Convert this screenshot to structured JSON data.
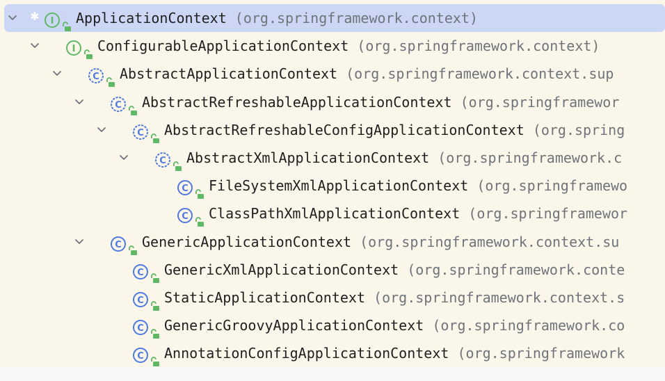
{
  "hierarchy": {
    "nodes": [
      {
        "name": "ApplicationContext",
        "package": "(org.springframework.context)",
        "kind": "interface",
        "depth": 0,
        "expanded": true,
        "selected": true,
        "starred": true
      },
      {
        "name": "ConfigurableApplicationContext",
        "package": "(org.springframework.context)",
        "kind": "interface",
        "depth": 1,
        "expanded": true
      },
      {
        "name": "AbstractApplicationContext",
        "package": "(org.springframework.context.sup",
        "kind": "abstract-class",
        "depth": 2,
        "expanded": true
      },
      {
        "name": "AbstractRefreshableApplicationContext",
        "package": "(org.springframewor",
        "kind": "abstract-class",
        "depth": 3,
        "expanded": true
      },
      {
        "name": "AbstractRefreshableConfigApplicationContext",
        "package": "(org.spring",
        "kind": "abstract-class",
        "depth": 4,
        "expanded": true
      },
      {
        "name": "AbstractXmlApplicationContext",
        "package": "(org.springframework.c",
        "kind": "abstract-class",
        "depth": 5,
        "expanded": true
      },
      {
        "name": "FileSystemXmlApplicationContext",
        "package": "(org.springframewo",
        "kind": "class",
        "depth": 6,
        "expanded": false
      },
      {
        "name": "ClassPathXmlApplicationContext",
        "package": "(org.springframewor",
        "kind": "class",
        "depth": 6,
        "expanded": false
      },
      {
        "name": "GenericApplicationContext",
        "package": "(org.springframework.context.su",
        "kind": "class",
        "depth": 3,
        "expanded": true
      },
      {
        "name": "GenericXmlApplicationContext",
        "package": "(org.springframework.conte",
        "kind": "class",
        "depth": 4,
        "expanded": false
      },
      {
        "name": "StaticApplicationContext",
        "package": "(org.springframework.context.s",
        "kind": "class",
        "depth": 4,
        "expanded": false
      },
      {
        "name": "GenericGroovyApplicationContext",
        "package": "(org.springframework.co",
        "kind": "class",
        "depth": 4,
        "expanded": false
      },
      {
        "name": "AnnotationConfigApplicationContext",
        "package": "(org.springframework",
        "kind": "class",
        "depth": 4,
        "expanded": false
      }
    ]
  },
  "icons": {
    "interface": "interface-icon",
    "class": "class-icon",
    "abstract-class": "abstract-class-icon",
    "expanded": "chevron-down-icon",
    "access": "public-access-icon",
    "starred": "star-icon"
  },
  "colors": {
    "selection": "#cbd7f4",
    "interface_icon": "#5fb865",
    "class_icon": "#4f78e0",
    "access_icon": "#5fb865",
    "background": "#fbf6ea"
  }
}
